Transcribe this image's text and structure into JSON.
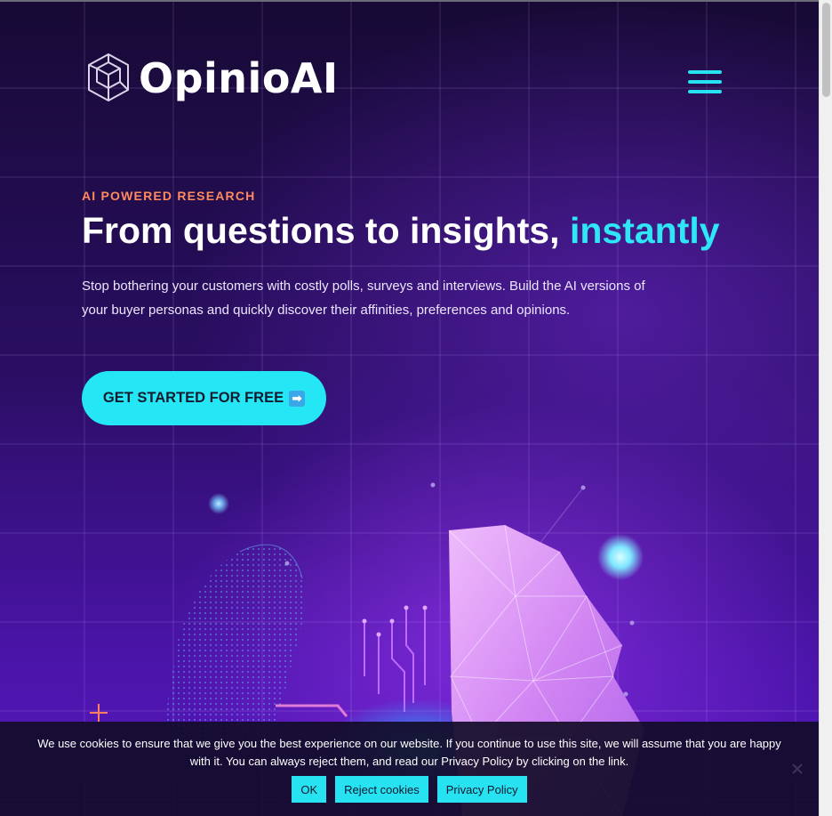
{
  "brand": {
    "name": "OpinioAI",
    "logo_icon": "hexagon-cube-icon"
  },
  "header": {
    "menu_icon": "hamburger-menu-icon"
  },
  "hero": {
    "eyebrow": "AI POWERED RESEARCH",
    "headline_main": "From questions to insights, ",
    "headline_accent": "instantly",
    "description": "Stop bothering your customers with costly polls, surveys and interviews. Build the AI versions of your buyer personas and quickly discover their affinities, preferences and opinions.",
    "cta_label": "GET STARTED FOR FREE",
    "cta_icon": "right-arrow-emoji-icon",
    "cta_icon_glyph": "➡"
  },
  "cookie_notice": {
    "message": "We use cookies to ensure that we give you the best experience on our website. If you continue to use this site, we will assume that you are happy with it. You can always reject them, and read our Privacy Policy by clicking on the link.",
    "ok_label": "OK",
    "reject_label": "Reject cookies",
    "policy_label": "Privacy Policy",
    "close_icon": "close-icon"
  },
  "colors": {
    "accent_cyan": "#27e3f2",
    "eyebrow_orange": "#ff8a5c",
    "background_dark": "#170a35",
    "background_purple": "#4a14a8"
  }
}
